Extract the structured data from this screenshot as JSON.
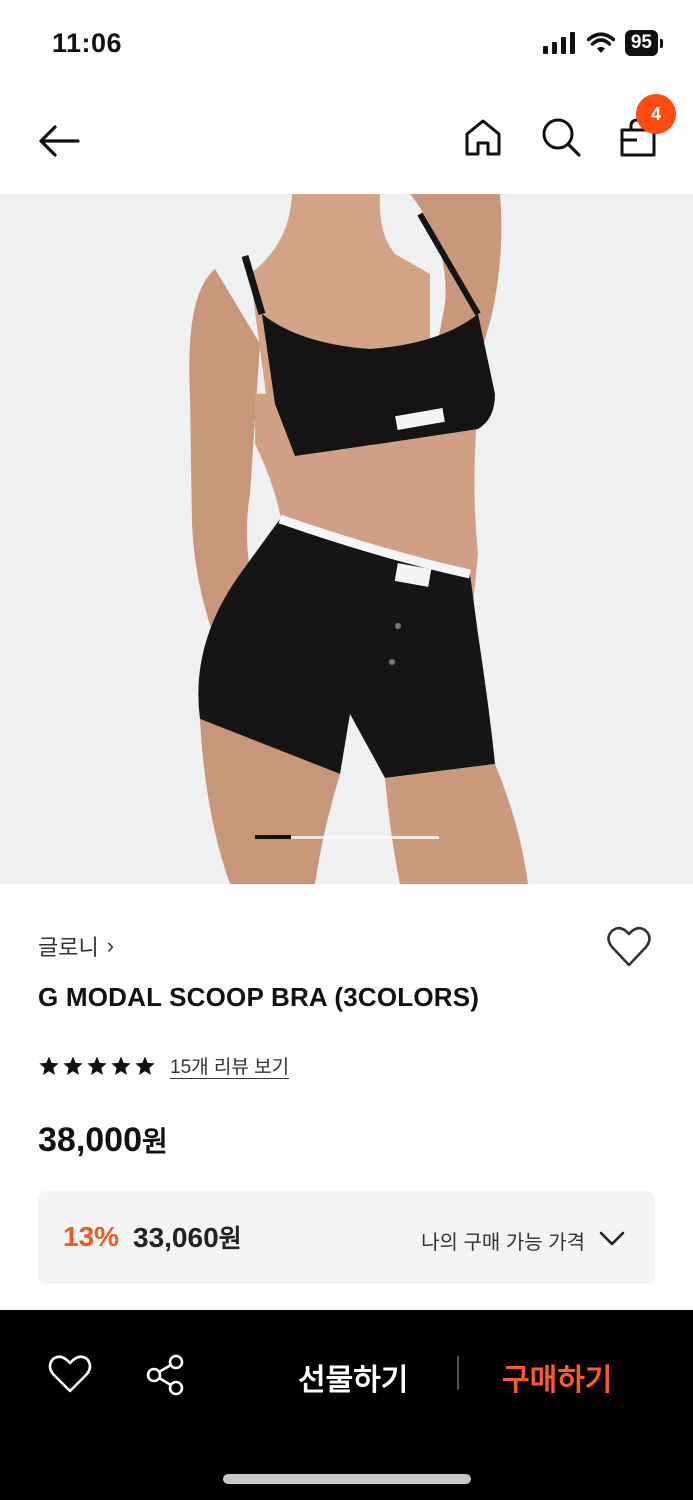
{
  "status_bar": {
    "time": "11:06",
    "battery": "95"
  },
  "nav": {
    "cart_count": "4"
  },
  "product": {
    "brand": "글로니",
    "brand_chevron": "›",
    "title": "G MODAL SCOOP BRA (3COLORS)",
    "rating_stars": 5,
    "review_link": "15개 리뷰 보기",
    "price_value": "38,000",
    "price_unit": "원"
  },
  "benefit": {
    "discount_rate": "13%",
    "discount_price_value": "33,060",
    "discount_price_unit": "원",
    "my_price_label": "나의 구매 가능 가격"
  },
  "bottom_bar": {
    "gift_label": "선물하기",
    "buy_label": "구매하기"
  },
  "gallery": {
    "current_page": 1,
    "total_pages": 5
  },
  "colors": {
    "accent": "#ff4b12",
    "discount": "#f05a1a",
    "buy": "#ff5a1f",
    "bar_bg": "#000000"
  },
  "icons": [
    "back-arrow-icon",
    "home-icon",
    "search-icon",
    "shopping-bag-icon",
    "heart-icon",
    "star-icon",
    "chevron-down-icon",
    "share-icon"
  ]
}
